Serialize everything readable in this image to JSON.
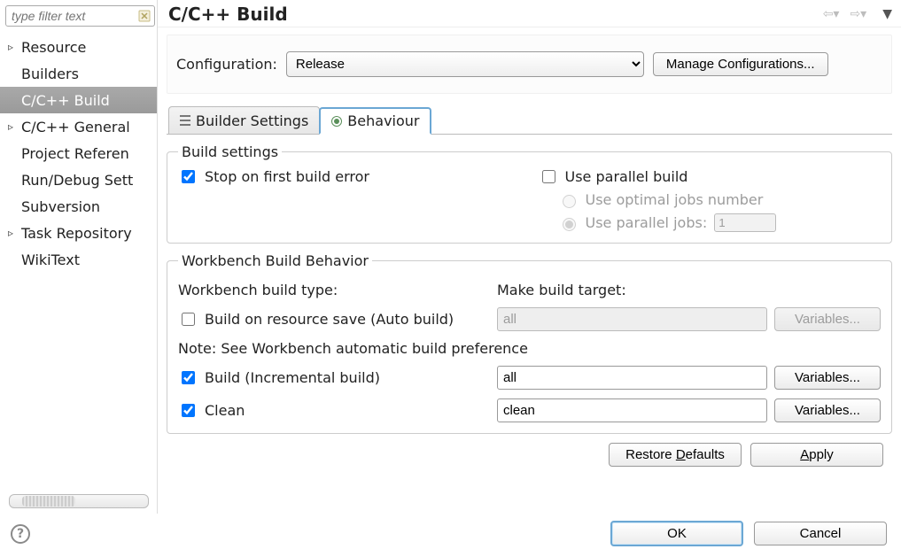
{
  "sidebar": {
    "filter_placeholder": "type filter text",
    "items": [
      {
        "label": "Resource",
        "expandable": true
      },
      {
        "label": "Builders",
        "expandable": false
      },
      {
        "label": "C/C++ Build",
        "expandable": false,
        "selected": true
      },
      {
        "label": "C/C++ General",
        "expandable": true
      },
      {
        "label": "Project Referen",
        "expandable": false
      },
      {
        "label": "Run/Debug Sett",
        "expandable": false
      },
      {
        "label": "Subversion",
        "expandable": false
      },
      {
        "label": "Task Repository",
        "expandable": true
      },
      {
        "label": "WikiText",
        "expandable": false
      }
    ]
  },
  "page_title": "C/C++ Build",
  "configuration": {
    "label": "Configuration:",
    "value": "Release",
    "manage_button": "Manage Configurations..."
  },
  "tabs": [
    {
      "id": "builder",
      "label": "Builder Settings"
    },
    {
      "id": "behaviour",
      "label": "Behaviour",
      "active": true
    }
  ],
  "build_settings": {
    "legend": "Build settings",
    "stop_on_first_error": {
      "label": "Stop on first build error",
      "checked": true
    },
    "use_parallel_build": {
      "label": "Use parallel build",
      "checked": false
    },
    "use_optimal_jobs": {
      "label": "Use optimal jobs number",
      "selected": false,
      "disabled": true
    },
    "use_parallel_jobs": {
      "label": "Use parallel jobs:",
      "selected": true,
      "disabled": true,
      "value": "1"
    }
  },
  "workbench": {
    "legend": "Workbench Build Behavior",
    "col1_header": "Workbench build type:",
    "col2_header": "Make build target:",
    "auto_build": {
      "label": "Build on resource save (Auto build)",
      "checked": false,
      "target": "all",
      "target_enabled": false,
      "vars_enabled": false
    },
    "note": "Note: See Workbench automatic build preference",
    "incremental": {
      "label": "Build (Incremental build)",
      "checked": true,
      "target": "all",
      "target_enabled": true,
      "vars_enabled": true
    },
    "clean": {
      "label": "Clean",
      "checked": true,
      "target": "clean",
      "target_enabled": true,
      "vars_enabled": true
    },
    "variables_button": "Variables..."
  },
  "buttons": {
    "restore_defaults": "Restore Defaults",
    "apply": "Apply",
    "ok": "OK",
    "cancel": "Cancel"
  }
}
